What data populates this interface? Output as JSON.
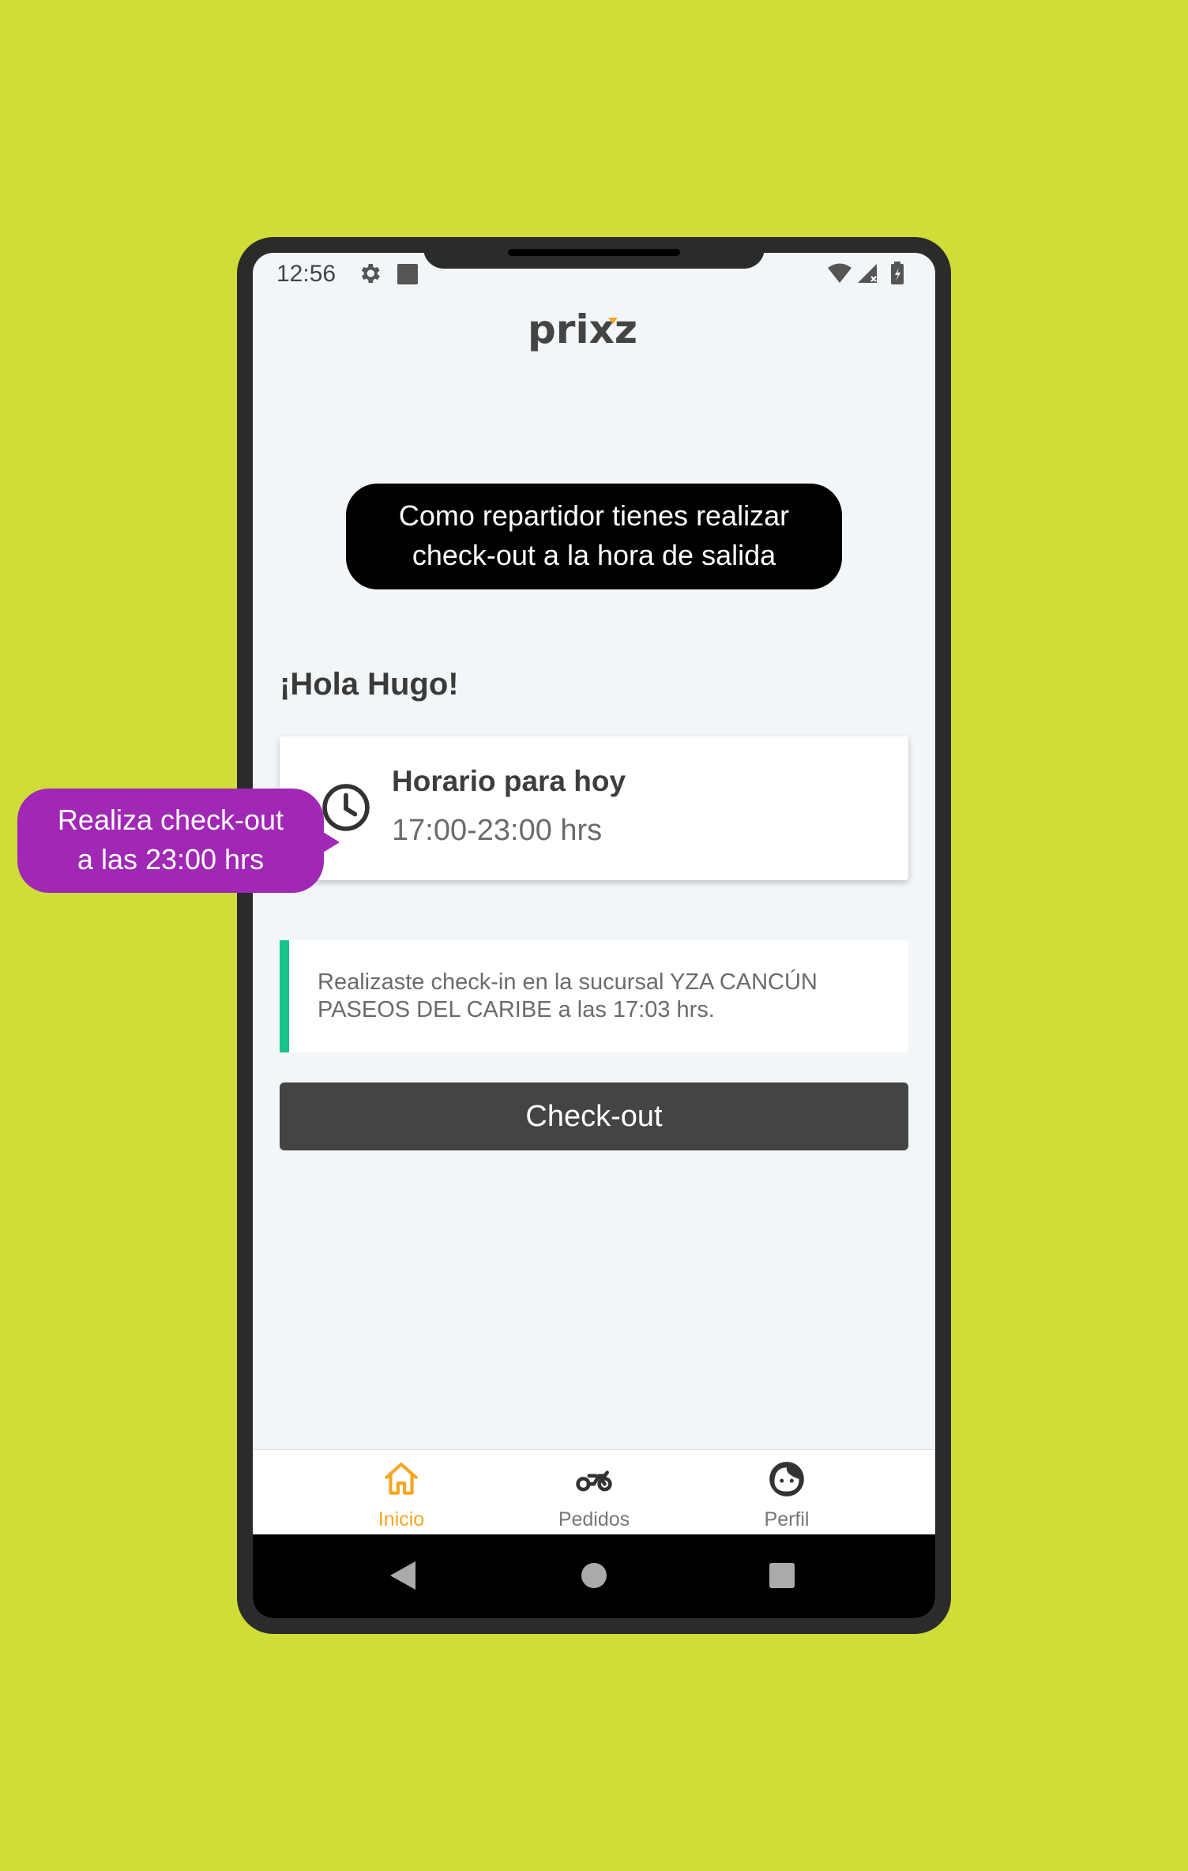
{
  "status_bar": {
    "time": "12:56"
  },
  "app": {
    "logo_text": "prixz",
    "brand_color": "#f5a623"
  },
  "tooltip_main": {
    "line1": "Como repartidor tienes realizar",
    "line2": "check-out a la hora de salida"
  },
  "greeting": "¡Hola Hugo!",
  "schedule": {
    "title": "Horario para hoy",
    "hours": "17:00-23:00 hrs",
    "icon": "clock-icon"
  },
  "tooltip_side": {
    "line1": "Realiza check-out",
    "line2": "a las 23:00 hrs"
  },
  "checkin": {
    "message": "Realizaste check-in en la sucursal YZA CANCÚN PASEOS DEL CARIBE a las 17:03 hrs.",
    "accent_color": "#19c28a"
  },
  "checkout_button": {
    "label": "Check-out"
  },
  "bottom_nav": {
    "items": [
      {
        "label": "Inicio",
        "icon": "home-icon",
        "active": true
      },
      {
        "label": "Pedidos",
        "icon": "motorcycle-icon",
        "active": false
      },
      {
        "label": "Perfil",
        "icon": "face-icon",
        "active": false
      }
    ]
  },
  "colors": {
    "background": "#cedd37",
    "tooltip_side": "#a028b5",
    "button": "#444444"
  }
}
